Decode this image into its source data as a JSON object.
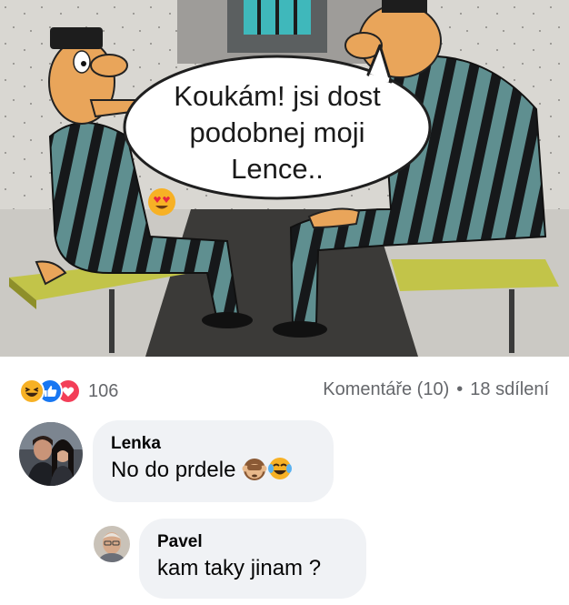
{
  "post": {
    "image": {
      "speech_bubble": {
        "line1": "Koukám! jsi dost",
        "line2": "podobnej moji",
        "line3": "Lence..",
        "emoji": "heart-eyes-emoji"
      }
    },
    "reactions": {
      "icons": [
        "haha-reaction-icon",
        "like-reaction-icon",
        "love-reaction-icon"
      ],
      "count": "106",
      "colors": {
        "like": "#1877f2",
        "love": "#f33e58",
        "haha": "#f7b125"
      }
    },
    "stats": {
      "comments": "Komentáře (10)",
      "separator": "•",
      "shares": "18 sdílení"
    }
  },
  "comments": [
    {
      "author": "Lenka",
      "text": "No do prdele",
      "emojis": [
        "see-no-evil-monkey-emoji",
        "tears-of-joy-emoji"
      ],
      "avatar": "couple-photo-avatar"
    },
    {
      "author": "Pavel",
      "text": "kam taky jinam ?",
      "avatar": "man-photo-avatar"
    }
  ],
  "colors": {
    "bubble_bg": "#f0f2f5",
    "meta_text": "#65676b"
  }
}
